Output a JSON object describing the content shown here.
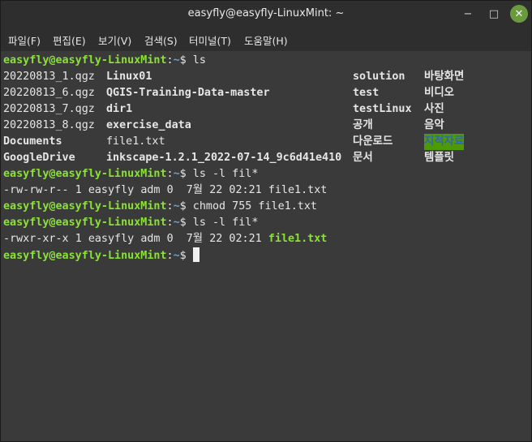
{
  "window": {
    "title": "easyfly@easyfly-LinuxMint: ~",
    "minimize_glyph": "−",
    "maximize_glyph": "□",
    "close_glyph": "✕"
  },
  "menubar": {
    "items": [
      "파일(F)",
      "편집(E)",
      "보기(V)",
      "검색(S)",
      "터미널(T)",
      "도움말(H)"
    ]
  },
  "colors": {
    "user_prompt": "#8ae234",
    "directory": "#729fcf",
    "executable": "#8ae234",
    "text": "#e6e6e6",
    "background": "#3a3a3a",
    "close_button": "#6a9a3e"
  },
  "terminal": {
    "prompt_user": "easyfly@easyfly-LinuxMint",
    "prompt_sep": ":",
    "prompt_path": "~",
    "prompt_symbol": "$",
    "commands": [
      "ls",
      "ls -l fil*",
      "chmod 755 file1.txt",
      "ls -l fil*"
    ],
    "ls_output": [
      [
        "20220813_1.qgz",
        "Linux01",
        "solution",
        "바탕화면"
      ],
      [
        "20220813_6.qgz",
        "QGIS-Training-Data-master",
        "test",
        "비디오"
      ],
      [
        "20220813_7.qgz",
        "dir1",
        "testLinux",
        "사진"
      ],
      [
        "20220813_8.qgz",
        "exercise_data",
        "공개",
        "음악"
      ],
      [
        "Documents",
        "file1.txt",
        "다운로드",
        "지적자료"
      ],
      [
        "GoogleDrive",
        "inkscape-1.2.1_2022-07-14_9c6d41e410",
        "문서",
        "템플릿"
      ]
    ],
    "ls_l_1": {
      "perms": "-rw-rw-r--",
      "links": "1",
      "owner": "easyfly",
      "group": "adm",
      "size": "0",
      "month": "7월",
      "day": "22",
      "time": "02:21",
      "name": "file1.txt"
    },
    "ls_l_2": {
      "perms": "-rwxr-xr-x",
      "links": "1",
      "owner": "easyfly",
      "group": "adm",
      "size": "0",
      "month": "7월",
      "day": "22",
      "time": "02:21",
      "name": "file1.txt"
    }
  }
}
